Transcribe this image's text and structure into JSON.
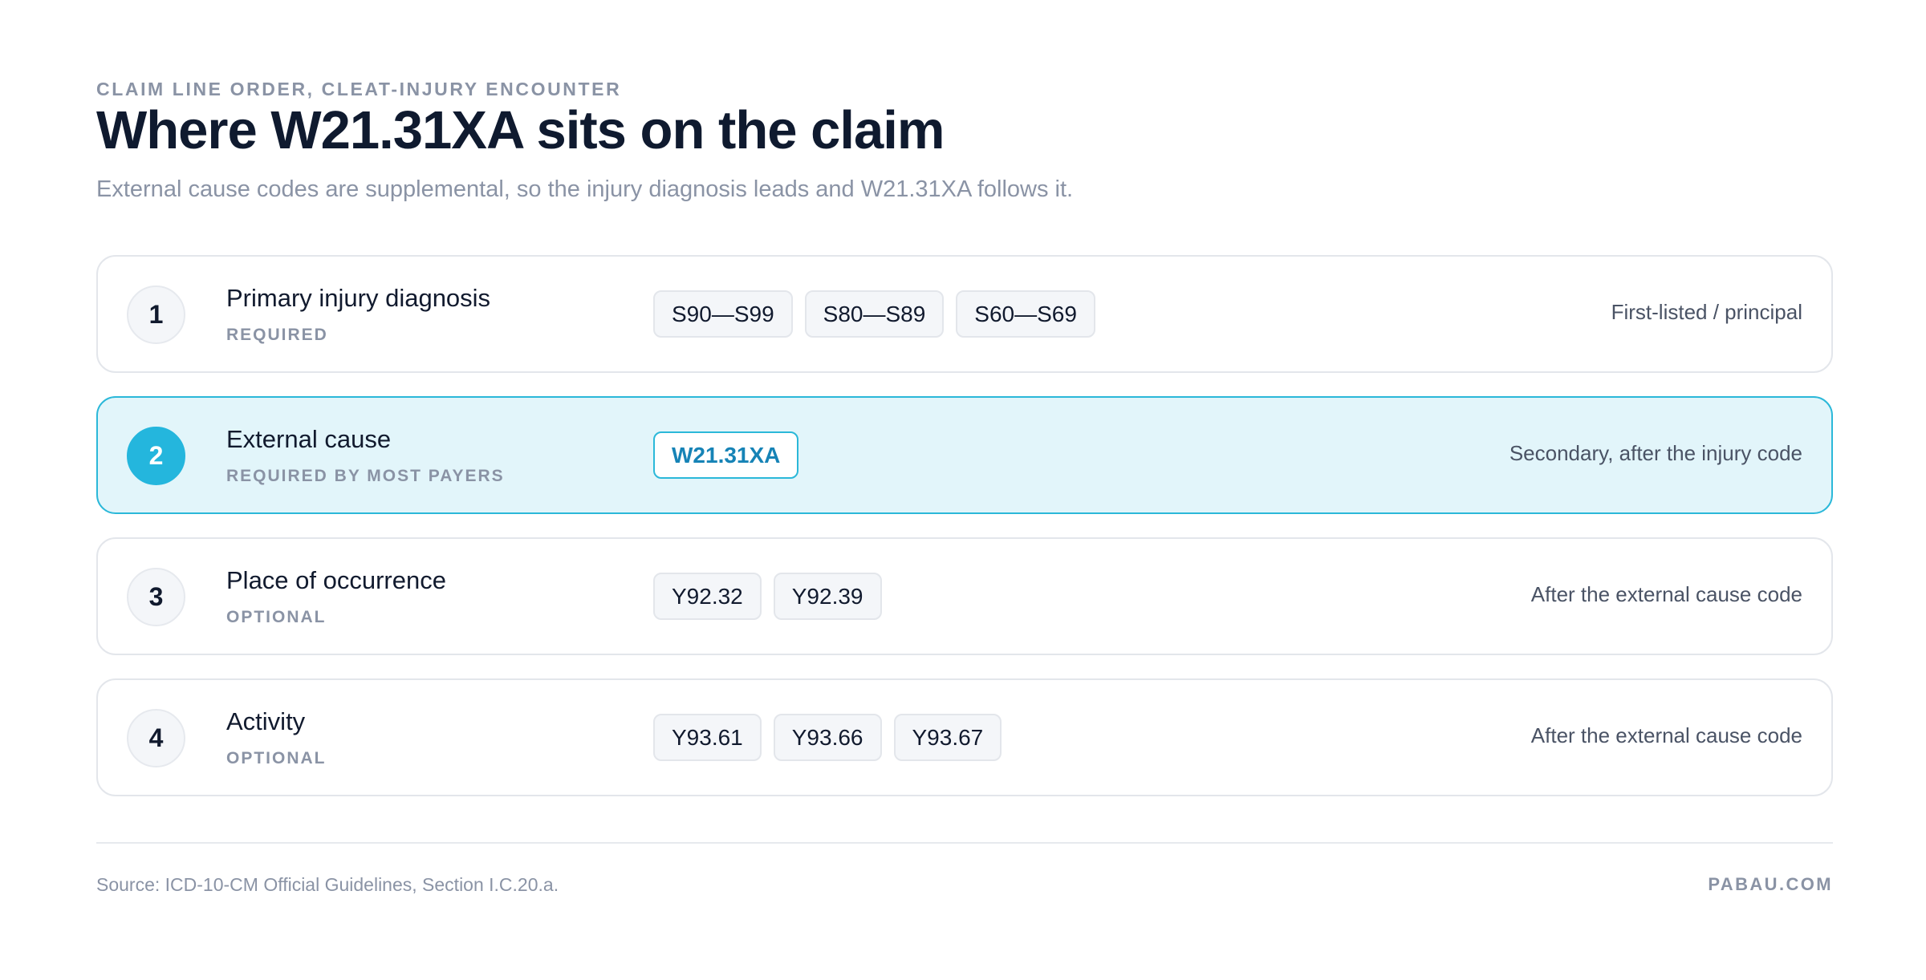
{
  "header": {
    "eyebrow": "CLAIM LINE ORDER, CLEAT-INJURY ENCOUNTER",
    "title": "Where W21.31XA sits on the claim",
    "subtitle": "External cause codes are supplemental, so the injury diagnosis leads and W21.31XA follows it."
  },
  "rows": [
    {
      "number": "1",
      "label": "Primary injury diagnosis",
      "requirement": "REQUIRED",
      "codes": [
        "S90—S99",
        "S80—S89",
        "S60—S69"
      ],
      "position_note": "First-listed / principal",
      "highlighted": false
    },
    {
      "number": "2",
      "label": "External cause",
      "requirement": "REQUIRED BY MOST PAYERS",
      "codes": [
        "W21.31XA"
      ],
      "position_note": "Secondary, after the injury code",
      "highlighted": true
    },
    {
      "number": "3",
      "label": "Place of occurrence",
      "requirement": "OPTIONAL",
      "codes": [
        "Y92.32",
        "Y92.39"
      ],
      "position_note": "After the external cause code",
      "highlighted": false
    },
    {
      "number": "4",
      "label": "Activity",
      "requirement": "OPTIONAL",
      "codes": [
        "Y93.61",
        "Y93.66",
        "Y93.67"
      ],
      "position_note": "After the external cause code",
      "highlighted": false
    }
  ],
  "footer": {
    "source": "Source: ICD-10-CM Official Guidelines, Section I.C.20.a.",
    "brand": "PABAU.COM"
  },
  "colors": {
    "accent": "#24b6dd",
    "highlight_bg": "#e2f5fa",
    "code_text_active": "#1683b6"
  }
}
